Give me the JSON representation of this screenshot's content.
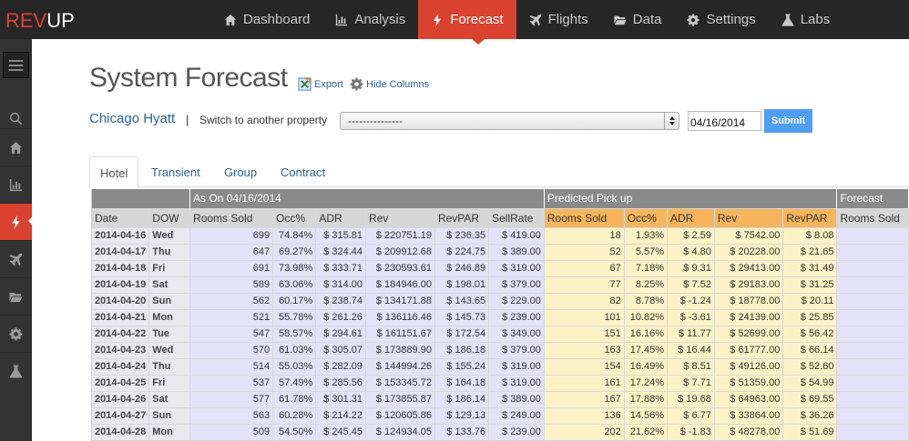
{
  "app": {
    "logo_rev": "REV",
    "logo_up": "UP"
  },
  "nav": [
    {
      "label": "Dashboard",
      "icon": "home-icon",
      "active": false
    },
    {
      "label": "Analysis",
      "icon": "bar-chart-icon",
      "active": false
    },
    {
      "label": "Forecast",
      "icon": "bolt-icon",
      "active": true
    },
    {
      "label": "Flights",
      "icon": "plane-icon",
      "active": false
    },
    {
      "label": "Data",
      "icon": "folder-icon",
      "active": false
    },
    {
      "label": "Settings",
      "icon": "gear-icon",
      "active": false
    },
    {
      "label": "Labs",
      "icon": "flask-icon",
      "active": false
    }
  ],
  "sidebar": [
    "search-icon",
    "home-icon",
    "bar-chart-icon",
    "bolt-icon",
    "plane-icon",
    "folder-icon",
    "gear-icon",
    "flask-icon"
  ],
  "page": {
    "title": "System Forecast",
    "export_label": "Export",
    "hide_columns_label": "Hide Columns",
    "property": "Chicago Hyatt",
    "separator": "|",
    "switch_label": "Switch to another property",
    "select_value": "---------------",
    "date_value": "04/16/2014",
    "submit_label": "Submit"
  },
  "tabs": [
    {
      "label": "Hotel",
      "active": true
    },
    {
      "label": "Transient",
      "active": false
    },
    {
      "label": "Group",
      "active": false
    },
    {
      "label": "Contract",
      "active": false
    }
  ],
  "table": {
    "groups": {
      "as_on": "As On 04/16/2014",
      "pickup": "Predicted Pick up",
      "forecast": "Forecast"
    },
    "headers": {
      "base": [
        "Date",
        "DOW"
      ],
      "as_on": [
        "Rooms Sold",
        "Occ%",
        "ADR",
        "Rev",
        "RevPAR",
        "SellRate"
      ],
      "pickup": [
        "Rooms Sold",
        "Occ%",
        "ADR",
        "Rev",
        "RevPAR"
      ],
      "forecast": [
        "Rooms Sold"
      ]
    },
    "rows": [
      [
        "2014-04-16",
        "Wed",
        "699",
        "74.84%",
        "$ 315.81",
        "$ 220751.19",
        "$ 236.35",
        "$ 419.00",
        "18",
        "1.93%",
        "$ 2.59",
        "$ 7542.00",
        "$ 8.08"
      ],
      [
        "2014-04-17",
        "Thu",
        "647",
        "69.27%",
        "$ 324.44",
        "$ 209912.68",
        "$ 224.75",
        "$ 389.00",
        "52",
        "5.57%",
        "$ 4.80",
        "$ 20228.00",
        "$ 21.65"
      ],
      [
        "2014-04-18",
        "Fri",
        "691",
        "73.98%",
        "$ 333.71",
        "$ 230593.61",
        "$ 246.89",
        "$ 319.00",
        "67",
        "7.18%",
        "$ 9.31",
        "$ 29413.00",
        "$ 31.49"
      ],
      [
        "2014-04-19",
        "Sat",
        "589",
        "63.06%",
        "$ 314.00",
        "$ 184946.00",
        "$ 198.01",
        "$ 379.00",
        "77",
        "8.25%",
        "$ 7.52",
        "$ 29183.00",
        "$ 31.25"
      ],
      [
        "2014-04-20",
        "Sun",
        "562",
        "60.17%",
        "$ 238.74",
        "$ 134171.88",
        "$ 143.65",
        "$ 229.00",
        "82",
        "8.78%",
        "$ -1.24",
        "$ 18778.00",
        "$ 20.11"
      ],
      [
        "2014-04-21",
        "Mon",
        "521",
        "55.78%",
        "$ 261.26",
        "$ 136116.46",
        "$ 145.73",
        "$ 239.00",
        "101",
        "10.82%",
        "$ -3.61",
        "$ 24139.00",
        "$ 25.85"
      ],
      [
        "2014-04-22",
        "Tue",
        "547",
        "58.57%",
        "$ 294.61",
        "$ 161151.67",
        "$ 172.54",
        "$ 349.00",
        "151",
        "16.16%",
        "$ 11.77",
        "$ 52699.00",
        "$ 56.42"
      ],
      [
        "2014-04-23",
        "Wed",
        "570",
        "61.03%",
        "$ 305.07",
        "$ 173889.90",
        "$ 186.18",
        "$ 379.00",
        "163",
        "17.45%",
        "$ 16.44",
        "$ 61777.00",
        "$ 66.14"
      ],
      [
        "2014-04-24",
        "Thu",
        "514",
        "55.03%",
        "$ 282.09",
        "$ 144994.26",
        "$ 155.24",
        "$ 319.00",
        "154",
        "16.49%",
        "$ 8.51",
        "$ 49126.00",
        "$ 52.60"
      ],
      [
        "2014-04-25",
        "Fri",
        "537",
        "57.49%",
        "$ 285.56",
        "$ 153345.72",
        "$ 164.18",
        "$ 319.00",
        "161",
        "17.24%",
        "$ 7.71",
        "$ 51359.00",
        "$ 54.99"
      ],
      [
        "2014-04-26",
        "Sat",
        "577",
        "61.78%",
        "$ 301.31",
        "$ 173855.87",
        "$ 186.14",
        "$ 389.00",
        "167",
        "17.88%",
        "$ 19.68",
        "$ 64963.00",
        "$ 69.55"
      ],
      [
        "2014-04-27",
        "Sun",
        "563",
        "60.28%",
        "$ 214.22",
        "$ 120605.86",
        "$ 129.13",
        "$ 249.00",
        "136",
        "14.56%",
        "$ 6.77",
        "$ 33864.00",
        "$ 36.26"
      ],
      [
        "2014-04-28",
        "Mon",
        "509",
        "54.50%",
        "$ 245.45",
        "$ 124934.05",
        "$ 133.76",
        "$ 239.00",
        "202",
        "21.62%",
        "$ -1.83",
        "$ 48278.00",
        "$ 51.69"
      ]
    ]
  },
  "colors": {
    "brand": "#d9422f",
    "topbar": "#262626",
    "sidebar": "#333333",
    "pickup_header": "#f6b55c",
    "pickup_cell": "#fbf3c6",
    "as_on_cell": "#e4e2f8",
    "submit": "#4f9ff3"
  }
}
